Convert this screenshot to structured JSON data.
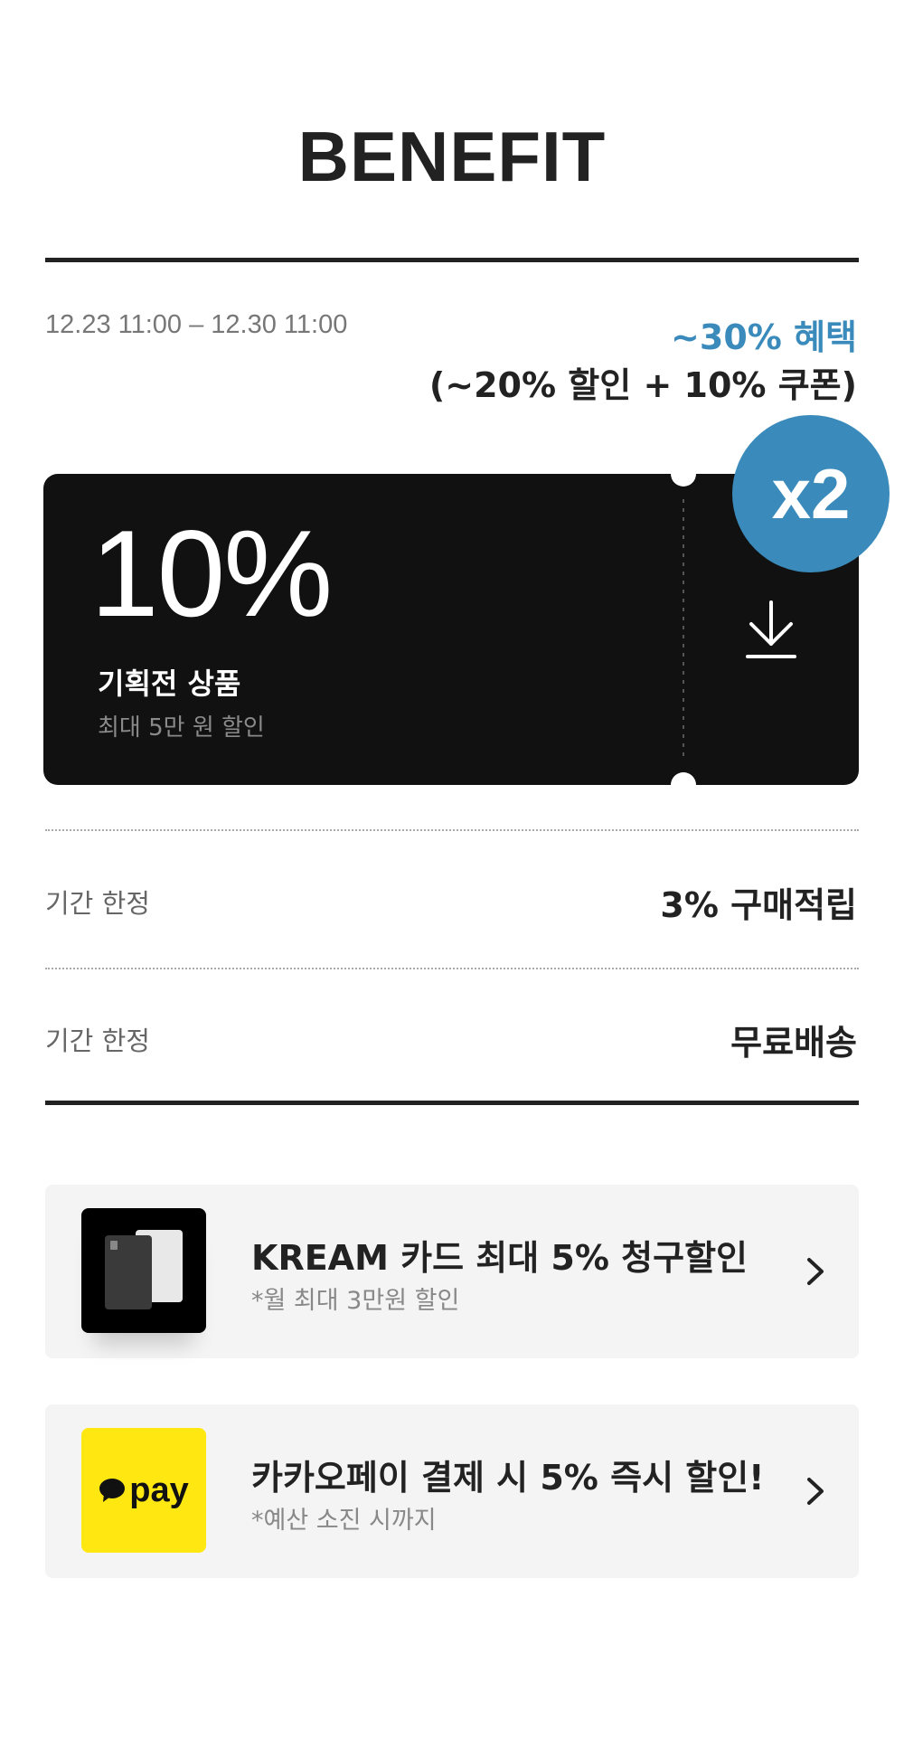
{
  "header": {
    "title": "BENEFIT"
  },
  "period": {
    "range": "12.23 11:00 – 12.30 11:00"
  },
  "benefit": {
    "total": "~30% 혜택",
    "detail": "(~20% 할인 + 10% 쿠폰)",
    "accent_color": "#3a8bbb"
  },
  "coupon": {
    "percent": "10%",
    "label": "기획전 상품",
    "sub": "최대 5만 원 할인",
    "badge": "x2",
    "download_icon": "download-icon"
  },
  "rows": [
    {
      "label": "기간 한정",
      "value": "3% 구매적립"
    },
    {
      "label": "기간 한정",
      "value": "무료배송"
    }
  ],
  "promos": [
    {
      "title": "KREAM 카드 최대 5% 청구할인",
      "sub": "*월 최대 3만원 할인",
      "icon": "kream-card-icon"
    },
    {
      "title": "카카오페이 결제 시 5% 즉시 할인!",
      "sub": "*예산 소진 시까지",
      "icon": "kakaopay-icon",
      "logo_text": "pay",
      "logo_color": "#ffe812"
    }
  ]
}
